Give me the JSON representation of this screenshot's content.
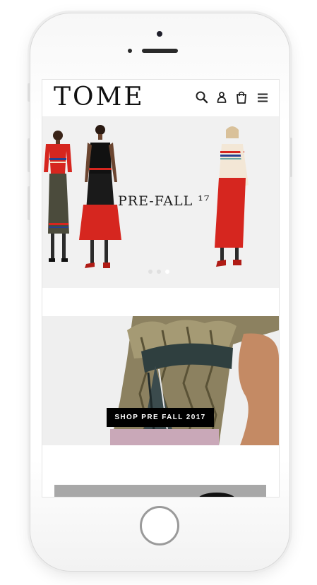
{
  "header": {
    "logo": "TOME",
    "icons": [
      "search-icon",
      "account-icon",
      "cart-icon",
      "menu-icon"
    ]
  },
  "hero": {
    "title": "PRE-FALL ¹⁷",
    "slides": 3,
    "active_slide": 3
  },
  "promo": {
    "button_label": "SHOP PRE FALL 2017"
  },
  "colors": {
    "brand_text": "#111111",
    "button_bg": "#000000",
    "button_text": "#ffffff",
    "hero_bg": "#f1f1f1",
    "accent_red": "#d6261f"
  }
}
